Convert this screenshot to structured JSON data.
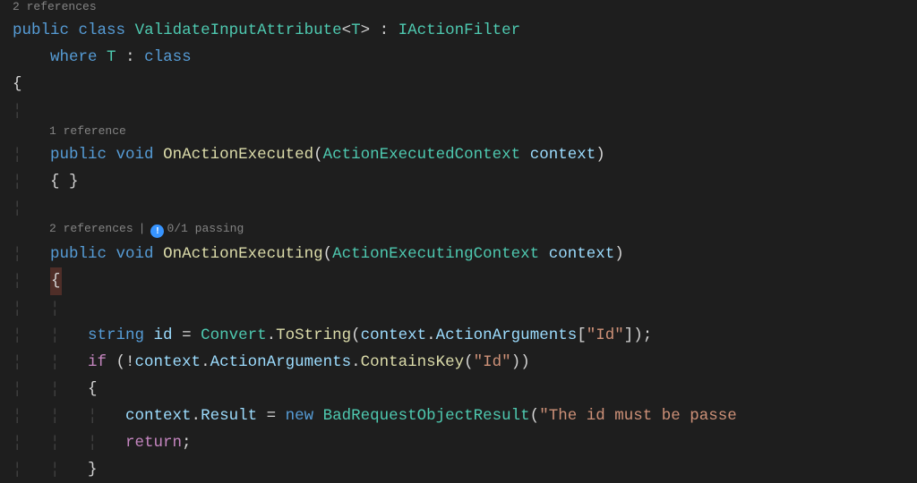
{
  "codelens": {
    "topRefs": "2 references",
    "method1Refs": "1 reference",
    "method2Refs": "2 references",
    "passing": "0/1 passing",
    "sep": "|"
  },
  "tokens": {
    "public": "public",
    "class": "class",
    "void": "void",
    "where": "where",
    "string": "string",
    "if": "if",
    "return": "return",
    "new": "new",
    "className": "ValidateInputAttribute",
    "T": "T",
    "IActionFilter": "IActionFilter",
    "constraint": "class",
    "OnActionExecuted": "OnActionExecuted",
    "ActionExecutedContext": "ActionExecutedContext",
    "OnActionExecuting": "OnActionExecuting",
    "ActionExecutingContext": "ActionExecutingContext",
    "context": "context",
    "id": "id",
    "Convert": "Convert",
    "ToString": "ToString",
    "ActionArguments": "ActionArguments",
    "ContainsKey": "ContainsKey",
    "Result": "Result",
    "BadRequestObjectResult": "BadRequestObjectResult",
    "strId": "\"Id\"",
    "strErr": "\"The id must be passe"
  }
}
